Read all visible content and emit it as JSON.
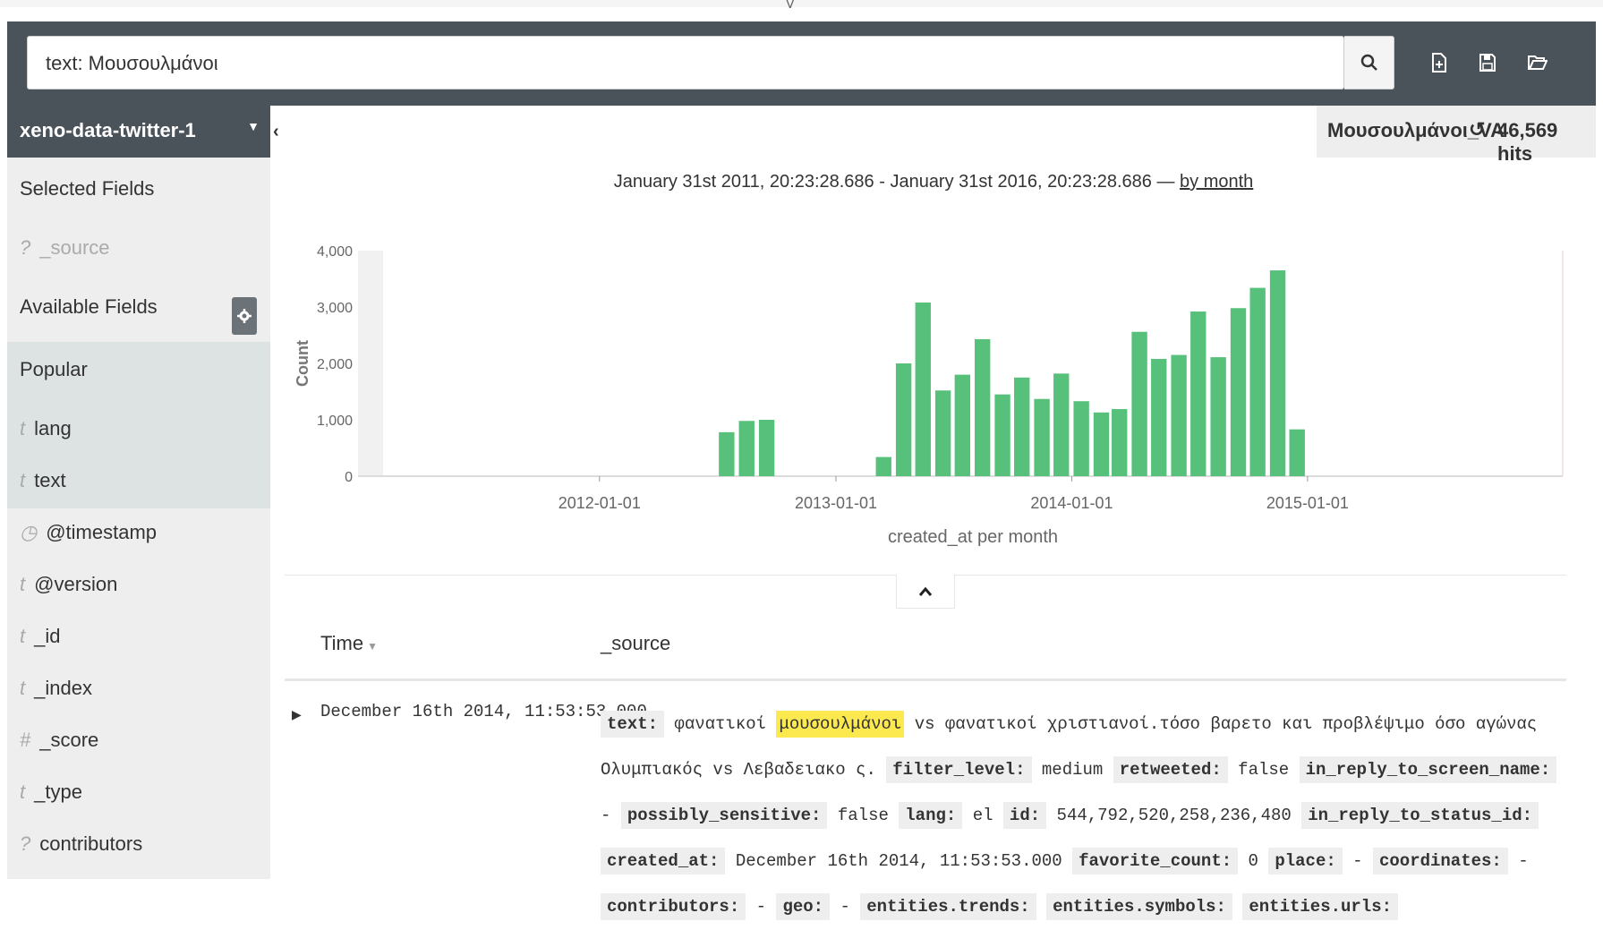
{
  "search": {
    "value": "text: Μουσουλμάνοι"
  },
  "icons": {
    "search": "search-icon",
    "new": "new-document-icon",
    "save": "save-icon",
    "open": "open-folder-icon",
    "gear": "gear-icon",
    "refresh": "refresh-icon",
    "collapse": "chevron-left-icon",
    "expand": "chevron-up-icon"
  },
  "sidebar": {
    "index_pattern": "xeno-data-twitter-1",
    "selected_title": "Selected Fields",
    "selected_fields": [
      {
        "type": "?",
        "name": "_source"
      }
    ],
    "available_title": "Available Fields",
    "popular_title": "Popular",
    "popular_fields": [
      {
        "type": "t",
        "name": "lang"
      },
      {
        "type": "t",
        "name": "text"
      }
    ],
    "fields": [
      {
        "type": "◷",
        "name": "@timestamp"
      },
      {
        "type": "t",
        "name": "@version"
      },
      {
        "type": "t",
        "name": "_id"
      },
      {
        "type": "t",
        "name": "_index"
      },
      {
        "type": "#",
        "name": "_score"
      },
      {
        "type": "t",
        "name": "_type"
      },
      {
        "type": "?",
        "name": "contributors"
      }
    ]
  },
  "header": {
    "saved_search": "Μουσουλμάνοι_VA",
    "hits": "46,569 hits"
  },
  "time_range": {
    "text": "January 31st 2011, 20:23:28.686 - January 31st 2016, 20:23:28.686 —",
    "interval": "by month"
  },
  "chart_data": {
    "type": "bar",
    "title": "",
    "xlabel": "created_at per month",
    "ylabel": "Count",
    "ylim": [
      0,
      4000
    ],
    "yticks": [
      "0",
      "1,000",
      "2,000",
      "3,000",
      "4,000"
    ],
    "xticks": [
      "2012-01-01",
      "2013-01-01",
      "2014-01-01",
      "2015-01-01"
    ],
    "x_range": [
      "2011-01-31",
      "2016-01-31"
    ],
    "categories": [
      "2012-07",
      "2012-08",
      "2012-09",
      "2013-03",
      "2013-04",
      "2013-05",
      "2013-06",
      "2013-07",
      "2013-08",
      "2013-09",
      "2013-10",
      "2013-11",
      "2013-12",
      "2014-01",
      "2014-02",
      "2014-03",
      "2014-04",
      "2014-05",
      "2014-06",
      "2014-07",
      "2014-08",
      "2014-09",
      "2014-10",
      "2014-11",
      "2014-12"
    ],
    "values": [
      780,
      980,
      1000,
      340,
      2000,
      3080,
      1520,
      1800,
      2430,
      1450,
      1750,
      1370,
      1820,
      1330,
      1130,
      1190,
      2560,
      2080,
      2150,
      2920,
      2110,
      2980,
      3340,
      3650,
      830
    ],
    "bar_color": "#57c17b"
  },
  "table": {
    "headers": {
      "time": "Time",
      "source": "_source"
    },
    "row": {
      "time": "December 16th 2014, 11:53:53.000",
      "text_key": "text:",
      "text_pre": "φανατικοί",
      "text_highlight": "μουσουλμάνοι",
      "text_post": "vs φανατικοί χριστιανοί.τόσο βαρετο και προβλέψιμο όσο αγώνας Ολυμπιακός vs Λεβαδειακο ς.",
      "fields": [
        {
          "k": "filter_level:",
          "v": "medium"
        },
        {
          "k": "retweeted:",
          "v": "false"
        },
        {
          "k": "in_reply_to_screen_name:",
          "v": "-"
        },
        {
          "k": "possibly_sensitive:",
          "v": "false"
        },
        {
          "k": "lang:",
          "v": "el"
        },
        {
          "k": "id:",
          "v": "544,792,520,258,236,480"
        },
        {
          "k": "in_reply_to_status_id:",
          "v": ""
        },
        {
          "k": "created_at:",
          "v": "December 16th 2014, 11:53:53.000"
        },
        {
          "k": "favorite_count:",
          "v": "0"
        },
        {
          "k": "place:",
          "v": "-"
        },
        {
          "k": "coordinates:",
          "v": "-"
        },
        {
          "k": "contributors:",
          "v": "-"
        },
        {
          "k": "geo:",
          "v": "-"
        },
        {
          "k": "entities.trends:",
          "v": ""
        },
        {
          "k": "entities.symbols:",
          "v": ""
        },
        {
          "k": "entities.urls:",
          "v": ""
        }
      ]
    }
  }
}
